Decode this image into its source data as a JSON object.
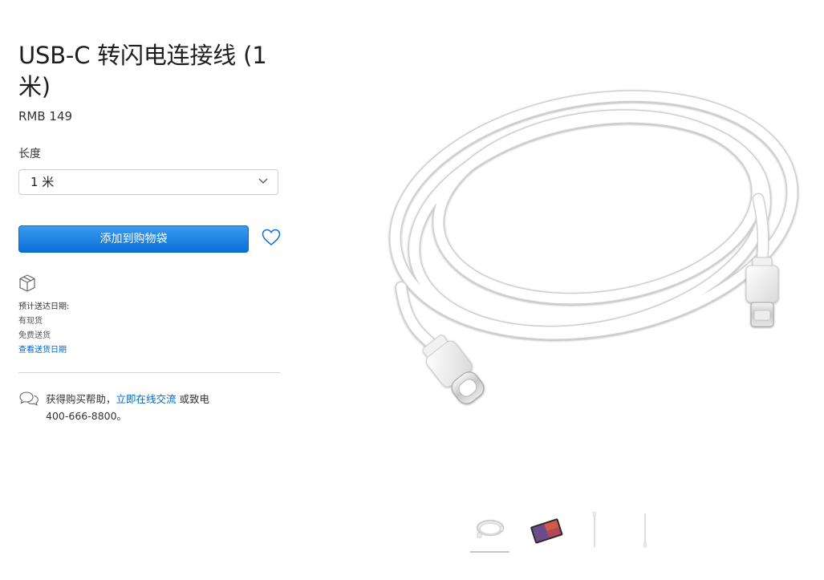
{
  "product": {
    "title": "USB-C 转闪电连接线 (1 米)",
    "price": "RMB 149"
  },
  "options": {
    "length_label": "长度",
    "length_selected": "1 米"
  },
  "actions": {
    "add_to_bag": "添加到购物袋"
  },
  "delivery": {
    "heading": "预计送达日期:",
    "stock": "有现货",
    "shipping": "免费送货",
    "check_link": "查看送货日期"
  },
  "help": {
    "prefix": "获得购买帮助，",
    "chat_link": "立即在线交流",
    "suffix": "或致电",
    "phone": "400-666-8800。"
  },
  "colors": {
    "primary_button": "#0a6fd6",
    "link": "#0066cc"
  },
  "icons": [
    "chevron-down-icon",
    "heart-icon",
    "box-icon",
    "chat-bubbles-icon"
  ],
  "gallery": {
    "thumbnail_count": 4,
    "selected_index": 0
  }
}
